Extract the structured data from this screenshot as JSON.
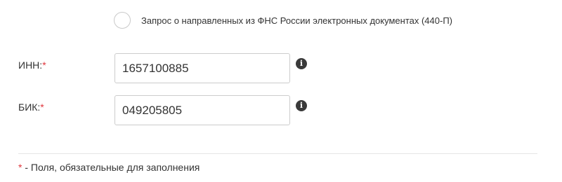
{
  "radio_option": {
    "label": "Запрос о направленных из ФНС России электронных документах (440-П)",
    "checked": false
  },
  "fields": {
    "inn": {
      "label": "ИНН:",
      "required_mark": "*",
      "value": "1657100885",
      "info_icon": "info-circle"
    },
    "bik": {
      "label": "БИК:",
      "required_mark": "*",
      "value": "049205805",
      "info_icon": "info-circle"
    }
  },
  "footnote": {
    "mark": "*",
    "text": " - Поля, обязательные для заполнения"
  },
  "colors": {
    "required": "#e0383e",
    "text": "#333333",
    "border": "#cccccc"
  }
}
